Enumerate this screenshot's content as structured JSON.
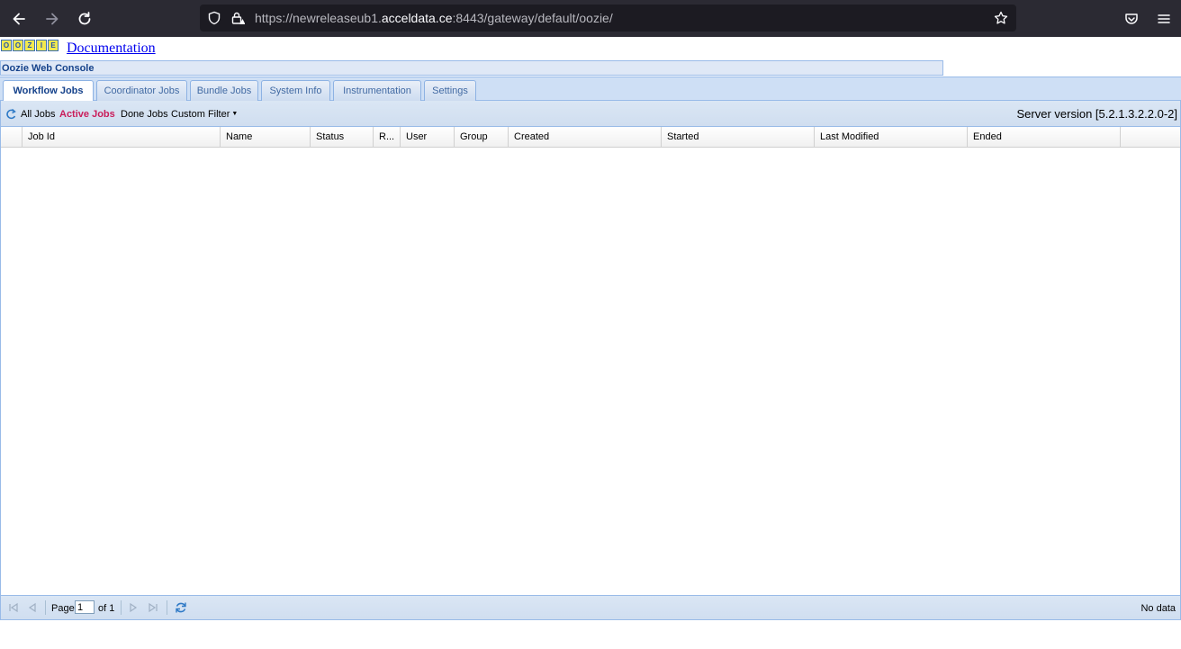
{
  "browser": {
    "url_prefix": "https://newreleaseub1.",
    "url_domain": "acceldata.ce",
    "url_suffix": ":8443/gateway/default/oozie/"
  },
  "header": {
    "logo_letters": [
      "O",
      "O",
      "Z",
      "I",
      "E"
    ],
    "documentation_link": "Documentation",
    "console_title": "Oozie Web Console"
  },
  "tabs": [
    {
      "label": "Workflow Jobs",
      "active": true
    },
    {
      "label": "Coordinator Jobs",
      "active": false
    },
    {
      "label": "Bundle Jobs",
      "active": false
    },
    {
      "label": "System Info",
      "active": false
    },
    {
      "label": "Instrumentation",
      "active": false
    },
    {
      "label": "Settings",
      "active": false
    }
  ],
  "toolbar": {
    "filters": [
      "All Jobs",
      "Active Jobs",
      "Done Jobs",
      "Custom Filter"
    ],
    "active_filter": "Active Jobs",
    "server_version": "Server version [5.2.1.3.2.2.0-2]"
  },
  "grid": {
    "columns": [
      "Job Id",
      "Name",
      "Status",
      "R...",
      "User",
      "Group",
      "Created",
      "Started",
      "Last Modified",
      "Ended"
    ],
    "rows": []
  },
  "paging": {
    "page_label": "Page",
    "current_page": "1",
    "of_label": "of 1",
    "status": "No data"
  },
  "colors": {
    "accent": "#15428b",
    "active_filter": "#c91c5a",
    "border": "#99bbe8"
  }
}
